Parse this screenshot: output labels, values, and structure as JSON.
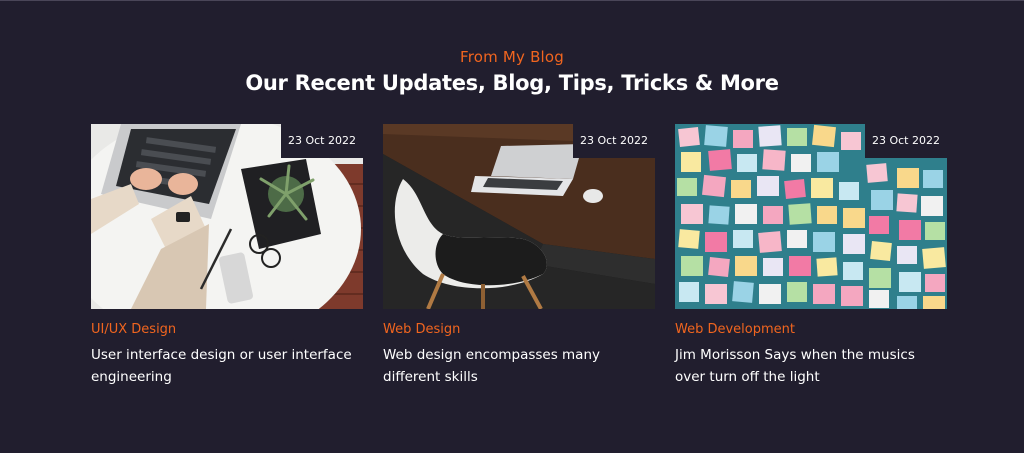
{
  "section": {
    "eyebrow": "From My Blog",
    "heading": "Our Recent Updates, Blog, Tips, Tricks & More"
  },
  "posts": [
    {
      "date": "23 Oct 2022",
      "category": "UI/UX Design",
      "title": "User interface design or user interface engineering",
      "image": "laptop-typing-desk-photo"
    },
    {
      "date": "23 Oct 2022",
      "category": "Web Design",
      "title": "Web design encompasses many different skills",
      "image": "desk-chair-laptop-photo"
    },
    {
      "date": "23 Oct 2022",
      "category": "Web Development",
      "title": "Jim Morisson Says when the musics over turn off the light",
      "image": "sticky-notes-wall-photo"
    }
  ],
  "colors": {
    "background": "#211e2e",
    "accent": "#f1651f",
    "text": "#ffffff"
  }
}
